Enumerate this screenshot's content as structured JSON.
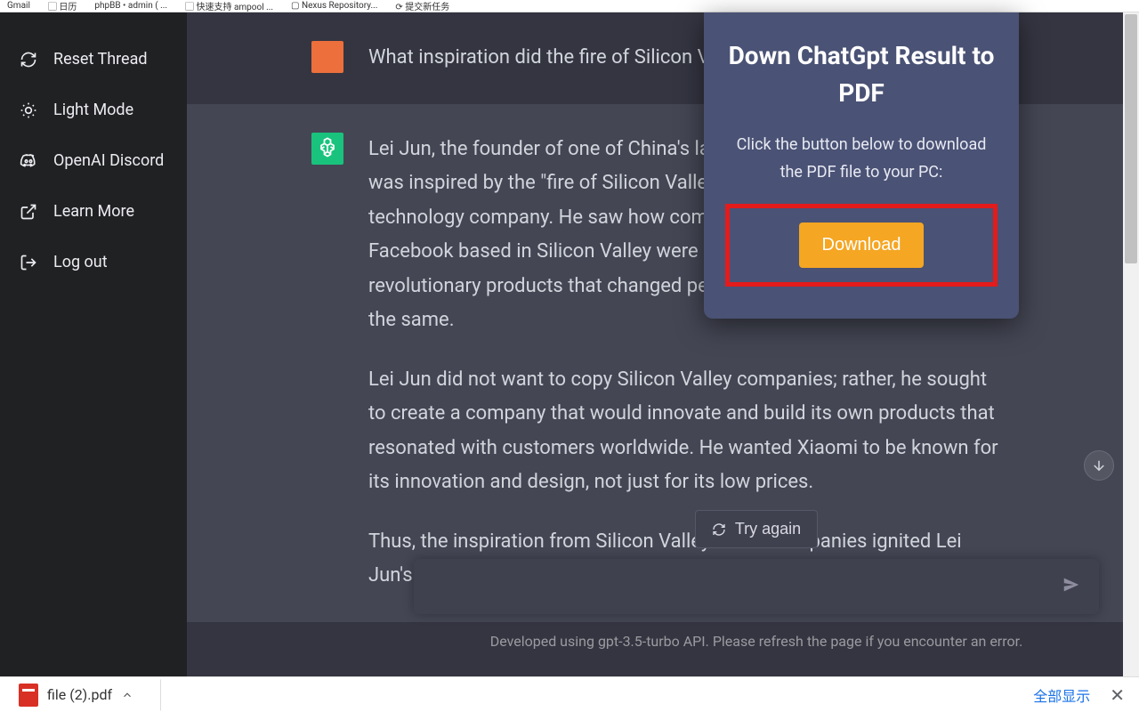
{
  "sidebar": {
    "items": [
      {
        "label": "Reset Thread",
        "icon": "refresh"
      },
      {
        "label": "Light Mode",
        "icon": "sun"
      },
      {
        "label": "OpenAI Discord",
        "icon": "discord"
      },
      {
        "label": "Learn More",
        "icon": "external"
      },
      {
        "label": "Log out",
        "icon": "logout"
      }
    ]
  },
  "chat": {
    "user_message": "What inspiration did the fire of Silicon Valley give",
    "assistant_message": {
      "p1": "Lei Jun, the founder of one of China's largest smartphone makers, Xiaomi, was inspired by the \"fire of Silicon Valley\" to create a world-renowned technology company. He saw how companies like Apple, Google, and Facebook based in Silicon Valley were able to create and launch revolutionary products that changed people's lives, and he wanted to do the same.",
      "p2": "Lei Jun did not want to copy Silicon Valley companies; rather, he sought to create a company that would innovate and build its own products that resonated with customers worldwide. He wanted Xiaomi to be known for its innovation and design, not just for its low prices.",
      "p3": "Thus, the inspiration from Silicon Valley's tech companies ignited Lei Jun's passion"
    }
  },
  "controls": {
    "try_again": "Try again",
    "footer": "Developed using gpt-3.5-turbo API. Please refresh the page if you encounter an error."
  },
  "popup": {
    "title": "Down ChatGpt Result to PDF",
    "subtitle": "Click the button below to download the PDF file to your PC:",
    "button": "Download"
  },
  "downloads": {
    "filename": "file (2).pdf",
    "show_all": "全部显示"
  }
}
